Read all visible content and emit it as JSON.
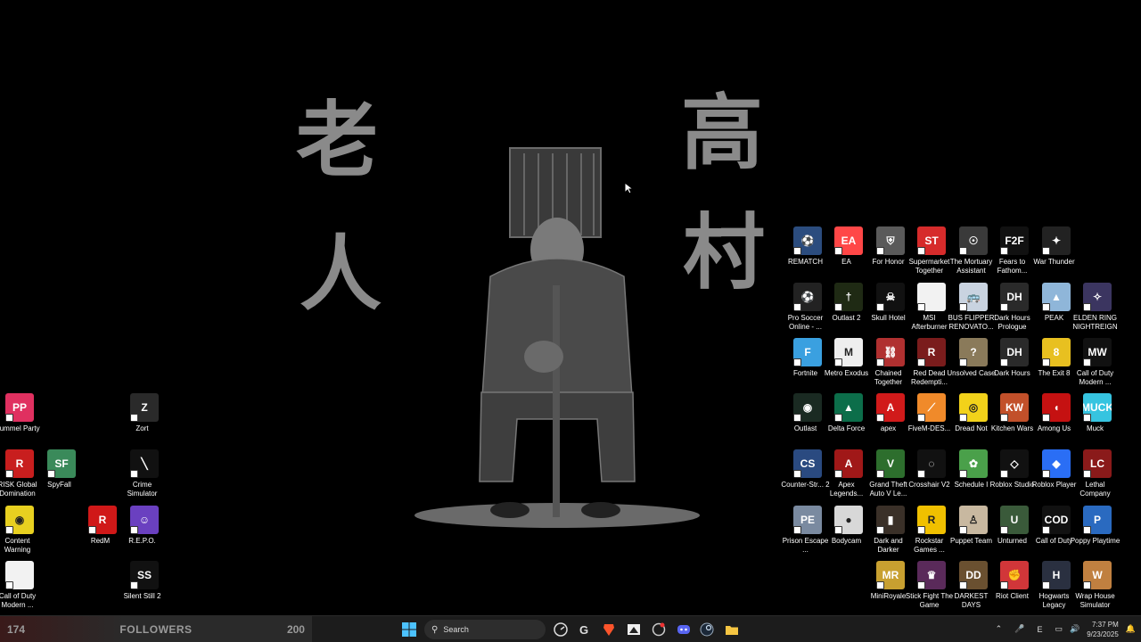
{
  "wallpaper": {
    "kanji_left_top": "老",
    "kanji_left_bottom": "人",
    "kanji_right_top": "高",
    "kanji_right_bottom": "村"
  },
  "desktop_icons": [
    {
      "label": "REMATCH",
      "color": "#2b4c7e",
      "glyph": "⚽"
    },
    {
      "label": "EA",
      "color": "#ff4747",
      "glyph": "EA"
    },
    {
      "label": "For Honor",
      "color": "#5a5a5a",
      "glyph": "⛨"
    },
    {
      "label": "Supermarket Together",
      "color": "#d62b2b",
      "glyph": "ST"
    },
    {
      "label": "The Mortuary Assistant",
      "color": "#3a3a3a",
      "glyph": "☉"
    },
    {
      "label": "Fears to Fathom...",
      "color": "#111",
      "glyph": "F2F"
    },
    {
      "label": "War Thunder",
      "color": "#222",
      "glyph": "✦"
    },
    {
      "label": "Pro Soccer Online - ...",
      "color": "#222",
      "glyph": "⚽"
    },
    {
      "label": "Outlast 2",
      "color": "#1f2a14",
      "glyph": "†"
    },
    {
      "label": "Skull Hotel",
      "color": "#111",
      "glyph": "☠"
    },
    {
      "label": "MSI Afterburner",
      "color": "#f2f2f2",
      "glyph": ""
    },
    {
      "label": "BUS FLIPPER RENOVATO...",
      "color": "#c9d3e0",
      "glyph": "🚌"
    },
    {
      "label": "Dark Hours Prologue",
      "color": "#2a2a2a",
      "glyph": "DH"
    },
    {
      "label": "PEAK",
      "color": "#8fb6d9",
      "glyph": "▲"
    },
    {
      "label": "ELDEN RING NIGHTREIGN",
      "color": "#3b3560",
      "glyph": "✧"
    },
    {
      "label": "Fortnite",
      "color": "#3aa0e0",
      "glyph": "F"
    },
    {
      "label": "Metro Exodus",
      "color": "#eee",
      "glyph": "M"
    },
    {
      "label": "Chained Together",
      "color": "#b03030",
      "glyph": "⛓"
    },
    {
      "label": "Red Dead Redempti...",
      "color": "#7a1c1c",
      "glyph": "R"
    },
    {
      "label": "Unsolved Case",
      "color": "#8a7a5a",
      "glyph": "?"
    },
    {
      "label": "Dark Hours",
      "color": "#2a2a2a",
      "glyph": "DH"
    },
    {
      "label": "The Exit 8",
      "color": "#e8c020",
      "glyph": "8"
    },
    {
      "label": "Call of Duty Modern ...",
      "color": "#111",
      "glyph": "MW"
    },
    {
      "label": "Outlast",
      "color": "#1a2a22",
      "glyph": "◉"
    },
    {
      "label": "Delta Force",
      "color": "#0c6e4a",
      "glyph": "▲"
    },
    {
      "label": "apex",
      "color": "#d11a1a",
      "glyph": "A"
    },
    {
      "label": "FiveM-DES...",
      "color": "#f08a2a",
      "glyph": "⟋"
    },
    {
      "label": "Dread Not",
      "color": "#f2d21a",
      "glyph": "◎"
    },
    {
      "label": "Kitchen Wars",
      "color": "#c2502a",
      "glyph": "KW"
    },
    {
      "label": "Among Us",
      "color": "#c51111",
      "glyph": "◖"
    },
    {
      "label": "Muck",
      "color": "#36c4e0",
      "glyph": "MUCK"
    },
    {
      "label": "Counter-Str... 2",
      "color": "#2a4a80",
      "glyph": "CS"
    },
    {
      "label": "Apex Legends...",
      "color": "#a01818",
      "glyph": "A"
    },
    {
      "label": "Grand Theft Auto V Le...",
      "color": "#2d6e2d",
      "glyph": "V"
    },
    {
      "label": "Crosshair V2",
      "color": "#111",
      "glyph": "◌"
    },
    {
      "label": "Schedule I",
      "color": "#4aa04a",
      "glyph": "✿"
    },
    {
      "label": "Roblox Studio",
      "color": "#111",
      "glyph": "◇"
    },
    {
      "label": "Roblox Player",
      "color": "#2a6ef5",
      "glyph": "◆"
    },
    {
      "label": "Lethal Company",
      "color": "#8a1a1a",
      "glyph": "LC"
    },
    {
      "label": "Prison Escape ...",
      "color": "#7a8aa0",
      "glyph": "PE"
    },
    {
      "label": "Bodycam",
      "color": "#d8d8d8",
      "glyph": "●"
    },
    {
      "label": "Dark and Darker",
      "color": "#3a3028",
      "glyph": "▮"
    },
    {
      "label": "Rockstar Games ...",
      "color": "#f0c000",
      "glyph": "R"
    },
    {
      "label": "Puppet Team",
      "color": "#c8b8a0",
      "glyph": "♙"
    },
    {
      "label": "Unturned",
      "color": "#3a5a3a",
      "glyph": "U"
    },
    {
      "label": "Call of Duty",
      "color": "#111",
      "glyph": "COD"
    },
    {
      "label": "Poppy Playtime",
      "color": "#2a6ac0",
      "glyph": "P"
    },
    {
      "label": "MiniRoyale",
      "color": "#c8a030",
      "glyph": "MR"
    },
    {
      "label": "Stick Fight The Game",
      "color": "#5a2a5a",
      "glyph": "♛"
    },
    {
      "label": "DARKEST DAYS",
      "color": "#6a5030",
      "glyph": "DD"
    },
    {
      "label": "Riot Client",
      "color": "#d13639",
      "glyph": "✊"
    },
    {
      "label": "Hogwarts Legacy",
      "color": "#2a3040",
      "glyph": "H"
    },
    {
      "label": "Wrap House Simulator",
      "color": "#c08040",
      "glyph": "W"
    },
    {
      "label": "Pummel Party",
      "color": "#e03060",
      "glyph": "PP"
    },
    {
      "label": "Zort",
      "color": "#2a2a2a",
      "glyph": "Z"
    },
    {
      "label": "RISK Global Domination",
      "color": "#c81e1e",
      "glyph": "R"
    },
    {
      "label": "SpyFall",
      "color": "#3a8a5a",
      "glyph": "SF"
    },
    {
      "label": "Crime Simulator",
      "color": "#111",
      "glyph": "╲"
    },
    {
      "label": "Content Warning",
      "color": "#e8d020",
      "glyph": "◉"
    },
    {
      "label": "RedM",
      "color": "#d01818",
      "glyph": "R"
    },
    {
      "label": "R.E.P.O.",
      "color": "#6a40c0",
      "glyph": "☺"
    },
    {
      "label": "Call of Duty Modern ...",
      "color": "#f2f2f2",
      "glyph": ""
    },
    {
      "label": "Silent Still 2",
      "color": "#111",
      "glyph": "SS"
    }
  ],
  "taskbar": {
    "followers_current": "174",
    "followers_label": "FOLLOWERS",
    "followers_goal": "200",
    "search_label": "Search",
    "clock_time": "7:37 PM",
    "clock_date": "9/23/2025",
    "tray_lang": "E"
  }
}
